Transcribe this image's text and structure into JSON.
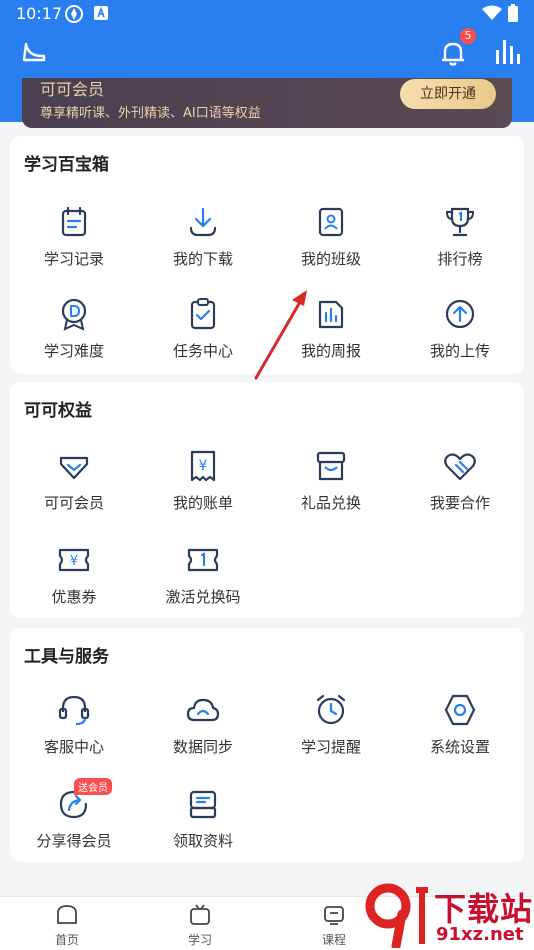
{
  "status_bar": {
    "time": "10:17"
  },
  "header": {
    "notification_count": "5"
  },
  "vip_banner": {
    "title": "可可会员",
    "description": "尊享精听课、外刊精读、AI口语等权益",
    "button": "立即开通"
  },
  "sections": [
    {
      "title": "学习百宝箱",
      "items": [
        {
          "label": "学习记录",
          "icon": "study-record-icon"
        },
        {
          "label": "我的下载",
          "icon": "download-icon"
        },
        {
          "label": "我的班级",
          "icon": "class-icon"
        },
        {
          "label": "排行榜",
          "icon": "trophy-icon"
        },
        {
          "label": "学习难度",
          "icon": "difficulty-badge-icon"
        },
        {
          "label": "任务中心",
          "icon": "task-clipboard-icon"
        },
        {
          "label": "我的周报",
          "icon": "weekly-report-icon"
        },
        {
          "label": "我的上传",
          "icon": "upload-icon"
        }
      ]
    },
    {
      "title": "可可权益",
      "items": [
        {
          "label": "可可会员",
          "icon": "vip-diamond-icon"
        },
        {
          "label": "我的账单",
          "icon": "bill-icon"
        },
        {
          "label": "礼品兑换",
          "icon": "gift-box-icon"
        },
        {
          "label": "我要合作",
          "icon": "handshake-heart-icon"
        },
        {
          "label": "优惠券",
          "icon": "coupon-icon"
        },
        {
          "label": "激活兑换码",
          "icon": "redeem-code-icon"
        }
      ]
    },
    {
      "title": "工具与服务",
      "items": [
        {
          "label": "客服中心",
          "icon": "headset-icon"
        },
        {
          "label": "数据同步",
          "icon": "cloud-sync-icon"
        },
        {
          "label": "学习提醒",
          "icon": "alarm-clock-icon"
        },
        {
          "label": "系统设置",
          "icon": "settings-hexagon-icon"
        },
        {
          "label": "分享得会员",
          "icon": "share-icon",
          "tag": "送会员"
        },
        {
          "label": "领取资料",
          "icon": "materials-icon"
        }
      ]
    }
  ],
  "tabbar": [
    {
      "label": "首页",
      "icon": "home-icon"
    },
    {
      "label": "学习",
      "icon": "study-tv-icon"
    },
    {
      "label": "课程",
      "icon": "course-icon"
    }
  ],
  "watermark": {
    "text": "下载站",
    "url": "91xz.net"
  },
  "colors": {
    "primary": "#2a7ff0",
    "icon_stroke": "#2b3b5a",
    "badge": "#ff4d4f",
    "vip_gold": "#e8d1a8"
  }
}
